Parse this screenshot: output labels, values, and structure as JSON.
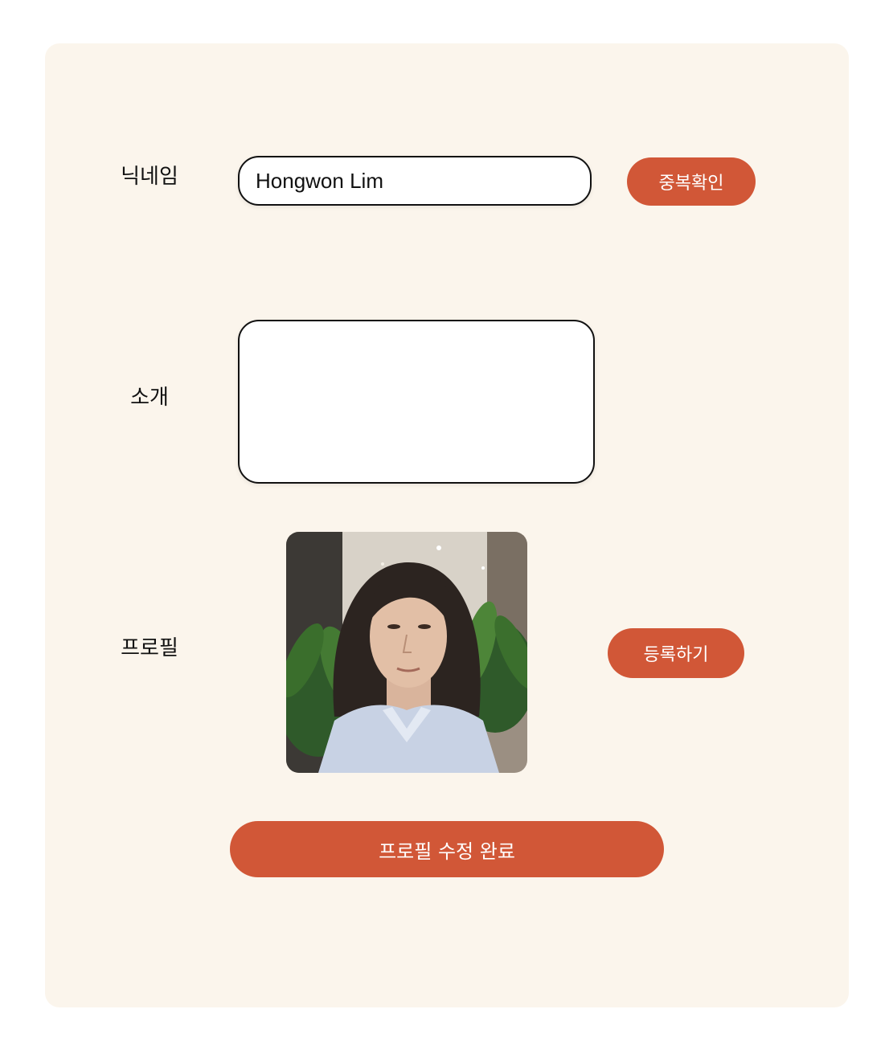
{
  "form": {
    "nickname_label": "닉네임",
    "nickname_value": "Hongwon Lim",
    "duplicate_check_label": "중복확인",
    "intro_label": "소개",
    "intro_value": "",
    "profile_label": "프로필",
    "register_label": "등록하기",
    "submit_label": "프로필 수정 완료"
  },
  "colors": {
    "card_bg": "#fbf5ec",
    "accent": "#d15737"
  },
  "profile_image": {
    "icon": "profile-photo"
  }
}
